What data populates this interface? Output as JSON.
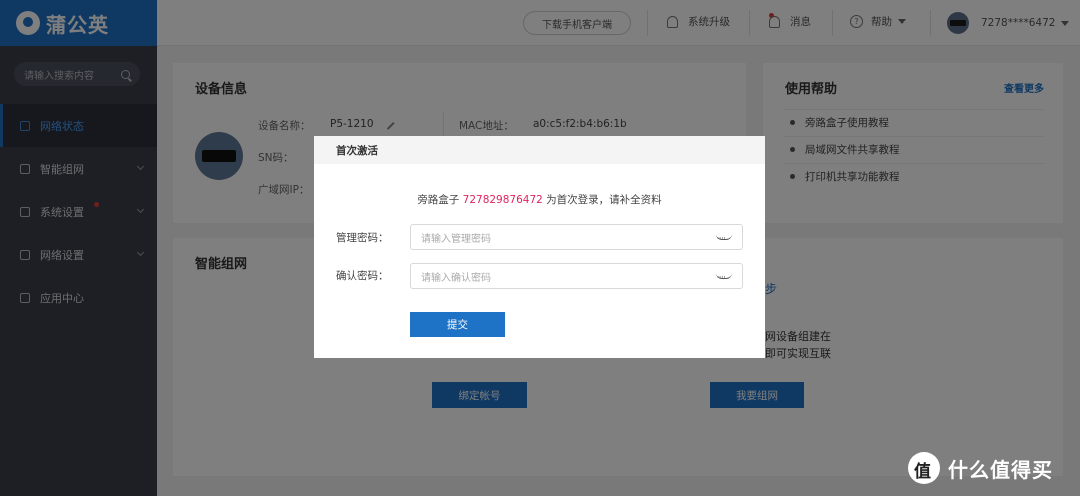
{
  "app": {
    "brand": "蒲公英"
  },
  "sidebar": {
    "search_placeholder": "请输入搜索内容",
    "items": [
      {
        "label": "网络状态",
        "icon": "status-icon",
        "active": true
      },
      {
        "label": "智能组网",
        "icon": "network-icon"
      },
      {
        "label": "系统设置",
        "icon": "settings-icon"
      },
      {
        "label": "网络设置",
        "icon": "net-settings-icon"
      },
      {
        "label": "应用中心",
        "icon": "apps-icon"
      }
    ]
  },
  "topbar": {
    "download_label": "下载手机客户端",
    "upgrade_label": "系统升级",
    "messages_label": "消息",
    "help_label": "帮助",
    "user_label": "7278****6472"
  },
  "device_info": {
    "title": "设备信息",
    "name_label": "设备名称：",
    "name_value": "P5-1210",
    "sn_label": "SN码：",
    "wan_label": "广域网IP：",
    "mac_label": "MAC地址：",
    "mac_value": "a0:c5:f2:b4:b6:1b"
  },
  "help_card": {
    "title": "使用帮助",
    "more_label": "查看更多",
    "items": [
      "旁路盒子使用教程",
      "局域网文件共享教程",
      "打印机共享功能教程"
    ]
  },
  "smart_network": {
    "title": "智能组网",
    "snippet_1": "步",
    "snippet_2": "网设备组建在",
    "snippet_3": "即可实现互联",
    "bind_button": "绑定帐号",
    "join_button": "我要组网"
  },
  "modal": {
    "title": "首次激活",
    "info_prefix": "旁路盒子",
    "info_id": "727829876472",
    "info_suffix": "为首次登录，请补全资料",
    "password_label": "管理密码：",
    "password_placeholder": "请输入管理密码",
    "confirm_label": "确认密码：",
    "confirm_placeholder": "请输入确认密码",
    "submit_label": "提交"
  },
  "watermark": {
    "text": "什么值得买"
  },
  "colors": {
    "brand_blue": "#1f73c6",
    "sidebar_bg": "#3a3f4b",
    "highlight_red": "#e0245e"
  }
}
